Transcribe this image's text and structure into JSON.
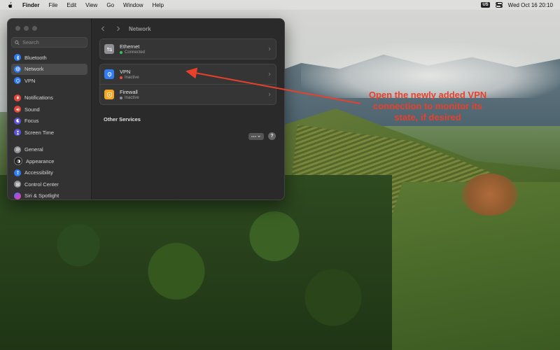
{
  "menubar": {
    "apple_icon": "apple-logo-icon",
    "app_name": "Finder",
    "menus": [
      "File",
      "Edit",
      "View",
      "Go",
      "Window",
      "Help"
    ],
    "input_source": "US",
    "control_center_icon": "control-center-icon",
    "datetime": "Wed Oct 16  20:10"
  },
  "window": {
    "title": "Network",
    "search_placeholder": "Search",
    "sidebar": [
      {
        "label": "Bluetooth",
        "icon": "bluetooth-icon",
        "color": "#2f7bf5"
      },
      {
        "label": "Network",
        "icon": "globe-icon",
        "color": "#2f7bf5",
        "active": true
      },
      {
        "label": "VPN",
        "icon": "vpn-icon",
        "color": "#2f7bf5"
      },
      {
        "label": "Notifications",
        "icon": "bell-icon",
        "color": "#e5483c"
      },
      {
        "label": "Sound",
        "icon": "speaker-icon",
        "color": "#e5483c"
      },
      {
        "label": "Focus",
        "icon": "moon-icon",
        "color": "#5e55d8"
      },
      {
        "label": "Screen Time",
        "icon": "hourglass-icon",
        "color": "#5e55d8"
      },
      {
        "label": "General",
        "icon": "gear-icon",
        "color": "#8e8e93"
      },
      {
        "label": "Appearance",
        "icon": "appearance-icon",
        "color": "#1c1c1e"
      },
      {
        "label": "Accessibility",
        "icon": "accessibility-icon",
        "color": "#2f7bf5"
      },
      {
        "label": "Control Center",
        "icon": "control-center-icon",
        "color": "#8e8e93"
      },
      {
        "label": "Siri & Spotlight",
        "icon": "siri-icon",
        "color": "#b04ad6"
      }
    ],
    "services": [
      {
        "name": "Ethernet",
        "status": "Connected",
        "status_color": "#34c759",
        "icon": "ethernet-icon",
        "icon_bg": "#8e8e93"
      },
      {
        "name": "VPN",
        "status": "Inactive",
        "status_color": "#ff453a",
        "icon": "vpn-globe-icon",
        "icon_bg": "#2f7bf5"
      },
      {
        "name": "Firewall",
        "status": "Inactive",
        "status_color": "#8e8e93",
        "icon": "firewall-icon",
        "icon_bg": "#f5a623"
      }
    ],
    "other_services_label": "Other Services",
    "help_label": "?"
  },
  "annotation": {
    "text": "Open the newly added VPN\nconnection to monitor its\nstate, if desired",
    "color": "#e8402b"
  }
}
